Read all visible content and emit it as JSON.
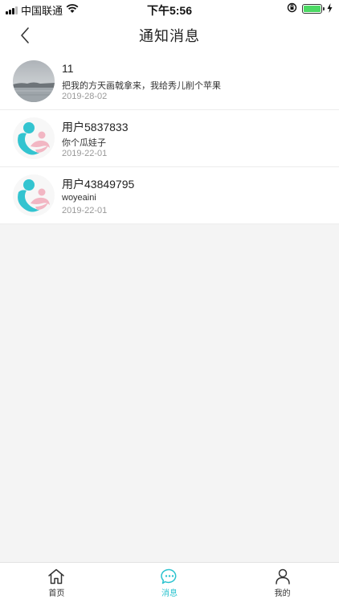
{
  "status_bar": {
    "carrier": "中国联通",
    "time": "下午5:56"
  },
  "nav": {
    "title": "通知消息"
  },
  "notifications": [
    {
      "name": "11",
      "message": "把我的方天画戟拿来，我给秀儿削个苹果",
      "date": "2019-28-02",
      "avatar": "landscape-photo"
    },
    {
      "name": "用户5837833",
      "message": "你个瓜娃子",
      "date": "2019-22-01",
      "avatar": "default-user-logo"
    },
    {
      "name": "用户43849795",
      "message": "woyeaini",
      "date": "2019-22-01",
      "avatar": "default-user-logo"
    }
  ],
  "tab_bar": {
    "tabs": [
      {
        "label": "首页",
        "icon": "home-icon",
        "active": false
      },
      {
        "label": "消息",
        "icon": "message-icon",
        "active": true
      },
      {
        "label": "我的",
        "icon": "profile-icon",
        "active": false
      }
    ],
    "active_color": "#2bc3cf"
  }
}
